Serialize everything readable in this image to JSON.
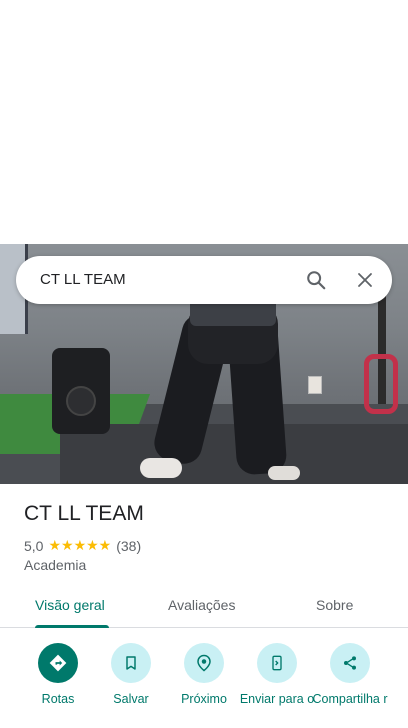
{
  "search": {
    "query": "CT LL TEAM"
  },
  "place": {
    "name": "CT LL TEAM",
    "rating": "5,0",
    "stars": "★★★★★",
    "review_count": "(38)",
    "category": "Academia"
  },
  "tabs": [
    {
      "label": "Visão geral",
      "active": true
    },
    {
      "label": "Avaliações",
      "active": false
    },
    {
      "label": "Sobre",
      "active": false
    }
  ],
  "actions": [
    {
      "label": "Rotas",
      "icon": "directions-icon"
    },
    {
      "label": "Salvar",
      "icon": "bookmark-icon"
    },
    {
      "label": "Próximo",
      "icon": "nearby-icon"
    },
    {
      "label": "Enviar para o",
      "icon": "send-to-phone-icon"
    },
    {
      "label": "Compartilha r",
      "icon": "share-icon"
    }
  ],
  "colors": {
    "accent": "#00796b",
    "action_bg": "#c9f0f4",
    "star": "#fbbc04"
  }
}
